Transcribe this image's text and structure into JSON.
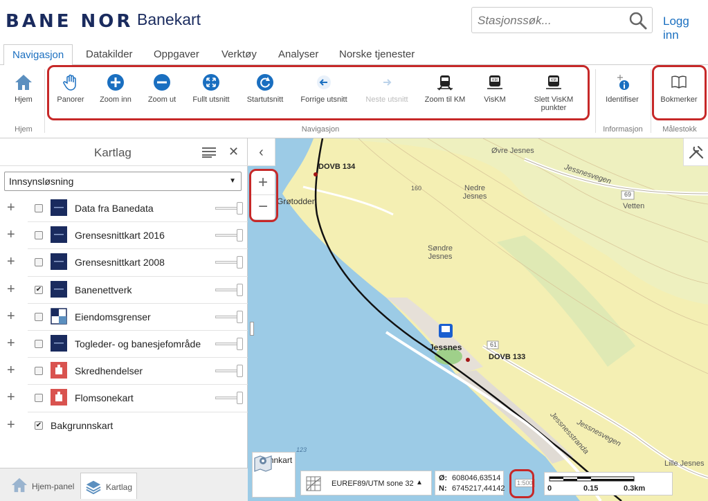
{
  "header": {
    "logo": "BANE NOR",
    "title": "Banekart",
    "search_placeholder": "Stasjonssøk...",
    "login": "Logg inn"
  },
  "tabs": [
    "Navigasjon",
    "Datakilder",
    "Oppgaver",
    "Verktøy",
    "Analyser",
    "Norske tjenester"
  ],
  "ribbon": {
    "home": "Hjem",
    "home_group": "Hjem",
    "nav": [
      "Panorer",
      "Zoom inn",
      "Zoom ut",
      "Fullt utsnitt",
      "Startutsnitt",
      "Forrige utsnitt",
      "Neste utsnitt",
      "Zoom til KM",
      "VisKM",
      "Slett VisKM punkter"
    ],
    "nav_group": "Navigasjon",
    "identify": "Identifiser",
    "info_group": "Informasjon",
    "bookmarks": "Bokmerker",
    "scale_group": "Målestokk"
  },
  "panel": {
    "title": "Kartlag",
    "select": "Innsynsløsning",
    "layers": [
      {
        "name": "Data fra Banedata",
        "checked": false,
        "icon": "banenor-icon"
      },
      {
        "name": "Grensesnittkart 2016",
        "checked": false,
        "icon": "banenor-icon"
      },
      {
        "name": "Grensesnittkart 2008",
        "checked": false,
        "icon": "banenor-icon"
      },
      {
        "name": "Banenettverk",
        "checked": true,
        "icon": "banenor-icon"
      },
      {
        "name": "Eiendomsgrenser",
        "checked": false,
        "icon": "grid-icon"
      },
      {
        "name": "Togleder- og banesjefområde",
        "checked": false,
        "icon": "banenor-icon"
      },
      {
        "name": "Skredhendelser",
        "checked": false,
        "icon": "hazard-icon"
      },
      {
        "name": "Flomsonekart",
        "checked": false,
        "icon": "hazard-icon"
      },
      {
        "name": "Bakgrunnskart",
        "checked": true,
        "icon": ""
      }
    ],
    "bottom_tabs": [
      "Hjem-panel",
      "Kartlag"
    ]
  },
  "map": {
    "labels": {
      "dovb134": "DOVB 134",
      "dovb133": "DOVB 133",
      "grotodden": "Grøtodden",
      "ovre_jesnes": "Øvre Jesnes",
      "nedre_jesnes": "Nedre Jesnes",
      "sondre_jesnes": "Søndre Jesnes",
      "jessnes": "Jessnes",
      "vetten": "Vetten",
      "jessnesvegen": "Jessnesvegen",
      "jessnesvegen2": "Jessnesvegen",
      "jessnesstranda": "Jessnesstranda",
      "lille_jesnes": "Lille Jesnes",
      "h160": "160",
      "h123": "123",
      "r69": "69",
      "r61": "61"
    },
    "grunnkart": "Grunnkart",
    "projection": "EUREF89/UTM sone 32",
    "coord_o_label": "Ø:",
    "coord_o": "608046,63514",
    "coord_n_label": "N:",
    "coord_n": "6745217,44142",
    "scale_button": "1:500",
    "scale_ticks": [
      "0",
      "0.15",
      "0.3km"
    ]
  },
  "colors": {
    "highlight": "#c62828",
    "brand": "#1a2b5e",
    "accent": "#1a6fc0",
    "water": "#9ccbe6",
    "land": "#f4efb3"
  }
}
